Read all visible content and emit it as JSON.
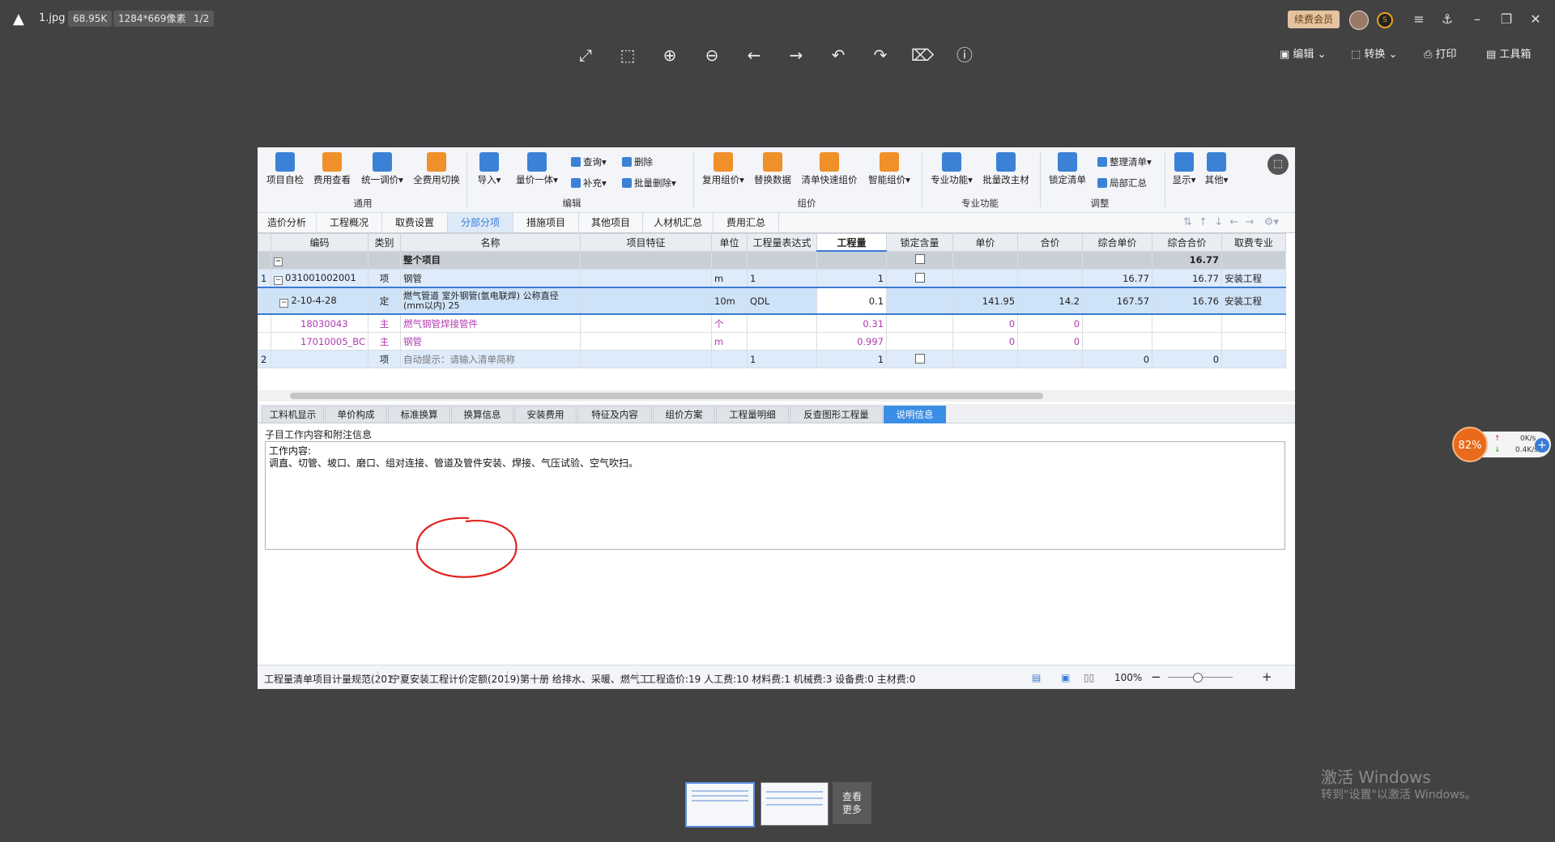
{
  "viewer": {
    "filename": "1.jpg",
    "filesize": "68.95K",
    "resolution": "1284*669像素",
    "page": "1/2",
    "vip_label": "续费会员",
    "menu": [
      "编辑",
      "转换",
      "打印",
      "工具箱"
    ],
    "toolbar_icons": [
      "fullscreen-icon",
      "fit-icon",
      "zoom-in-icon",
      "zoom-out-icon",
      "prev-icon",
      "next-icon",
      "rotate-left-icon",
      "rotate-right-icon",
      "delete-icon",
      "info-icon"
    ],
    "more_label_1": "查看",
    "more_label_2": "更多"
  },
  "ribbon": {
    "general": {
      "items": [
        "项目自检",
        "费用查看",
        "统一调价",
        "全费用切换"
      ],
      "group": "通用"
    },
    "edit": {
      "items": [
        "导入",
        "量价一体"
      ],
      "small": [
        "查询",
        "补充",
        "删除",
        "批量删除"
      ],
      "group": "编辑"
    },
    "pricing": {
      "items": [
        "复用组价",
        "替换数据",
        "清单快速组价",
        "智能组价"
      ],
      "group": "组价"
    },
    "special": {
      "items": [
        "专业功能",
        "批量改主材"
      ],
      "group": "专业功能"
    },
    "adjust": {
      "items": [
        "锁定清单"
      ],
      "small": [
        "整理清单",
        "局部汇总"
      ],
      "group": "调整"
    },
    "display": {
      "items": [
        "显示",
        "其他"
      ]
    }
  },
  "tabs": [
    "造价分析",
    "工程概况",
    "取费设置",
    "分部分项",
    "措施项目",
    "其他项目",
    "人材机汇总",
    "费用汇总"
  ],
  "active_tab": "分部分项",
  "grid": {
    "columns": [
      "编码",
      "类别",
      "名称",
      "项目特征",
      "单位",
      "工程量表达式",
      "工程量",
      "锁定含量",
      "单价",
      "合价",
      "综合单价",
      "综合合价",
      "取费专业"
    ],
    "rows": [
      {
        "no": "",
        "code": "",
        "type": "",
        "name": "整个项目",
        "unit": "",
        "expr": "",
        "qty": "",
        "price": "",
        "total": "",
        "uprice": "",
        "utotal": "16.77",
        "spec": ""
      },
      {
        "no": "1",
        "code": "031001002001",
        "type": "项",
        "name": "钢管",
        "unit": "m",
        "expr": "1",
        "qty": "1",
        "price": "",
        "total": "",
        "uprice": "16.77",
        "utotal": "16.77",
        "spec": "安装工程"
      },
      {
        "no": "",
        "code": "2-10-4-28",
        "type": "定",
        "name": "燃气管道 室外钢管(氩电联焊) 公称直径(mm以内) 25",
        "unit": "10m",
        "expr": "QDL",
        "qty": "0.1",
        "price": "141.95",
        "total": "14.2",
        "uprice": "167.57",
        "utotal": "16.76",
        "spec": "安装工程"
      },
      {
        "no": "",
        "code": "18030043",
        "type": "主",
        "name": "燃气钢管焊接管件",
        "unit": "个",
        "expr": "",
        "qty": "0.31",
        "price": "0",
        "total": "0",
        "uprice": "",
        "utotal": "",
        "spec": ""
      },
      {
        "no": "",
        "code": "17010005_BC",
        "type": "主",
        "name": "钢管",
        "unit": "m",
        "expr": "",
        "qty": "0.997",
        "price": "0",
        "total": "0",
        "uprice": "",
        "utotal": "",
        "spec": ""
      },
      {
        "no": "2",
        "code": "",
        "type": "项",
        "name": "自动提示：请输入清单简称",
        "unit": "",
        "expr": "1",
        "qty": "1",
        "price": "",
        "total": "",
        "uprice": "0",
        "utotal": "0",
        "spec": ""
      }
    ]
  },
  "bottom_tabs": [
    "工料机显示",
    "单价构成",
    "标准换算",
    "换算信息",
    "安装费用",
    "特征及内容",
    "组价方案",
    "工程量明细",
    "反查图形工程量",
    "说明信息"
  ],
  "active_bottom_tab": "说明信息",
  "info": {
    "title": "子目工作内容和附注信息",
    "line1": "工作内容:",
    "line2": "调直、切管、坡口、磨口、组对连接、管道及管件安装、焊接、气压试验、空气吹扫。"
  },
  "status": {
    "spec1": "工程量清单项目计量规范(201",
    "spec2": "宁夏安装工程计价定额(2019)",
    "spec3": "第十册 给排水、采暖、燃气工",
    "summary": "工程造价:19  人工费:10  材料费:1  机械费:3  设备费:0  主材费:0",
    "zoom": "100%"
  },
  "speed_widget": {
    "percent": "82%",
    "up": "0K/s",
    "down": "0.4K/s"
  },
  "watermark": {
    "line1": "激活 Windows",
    "line2": "转到\"设置\"以激活 Windows。"
  }
}
